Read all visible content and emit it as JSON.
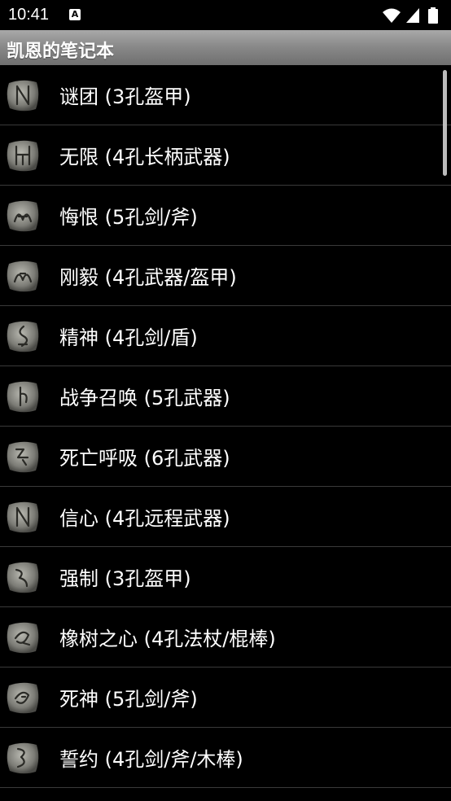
{
  "status": {
    "time": "10:41",
    "notification_letter": "A"
  },
  "app": {
    "title": "凯恩的笔记本"
  },
  "items": [
    {
      "label": "谜团 (3孔盔甲)",
      "rune": "rune-icon"
    },
    {
      "label": "无限 (4孔长柄武器)",
      "rune": "rune-icon"
    },
    {
      "label": "悔恨 (5孔剑/斧)",
      "rune": "rune-icon"
    },
    {
      "label": "刚毅 (4孔武器/盔甲)",
      "rune": "rune-icon"
    },
    {
      "label": "精神 (4孔剑/盾)",
      "rune": "rune-icon"
    },
    {
      "label": "战争召唤 (5孔武器)",
      "rune": "rune-icon"
    },
    {
      "label": "死亡呼吸 (6孔武器)",
      "rune": "rune-icon"
    },
    {
      "label": "信心 (4孔远程武器)",
      "rune": "rune-icon"
    },
    {
      "label": "强制 (3孔盔甲)",
      "rune": "rune-icon"
    },
    {
      "label": "橡树之心 (4孔法杖/棍棒)",
      "rune": "rune-icon"
    },
    {
      "label": "死神 (5孔剑/斧)",
      "rune": "rune-icon"
    },
    {
      "label": "誓约 (4孔剑/斧/木棒)",
      "rune": "rune-icon"
    }
  ],
  "colors": {
    "background": "#000000",
    "divider": "#3a3a3a",
    "appbar_top": "#a9a9a9",
    "appbar_bottom": "#6f6f6f"
  }
}
